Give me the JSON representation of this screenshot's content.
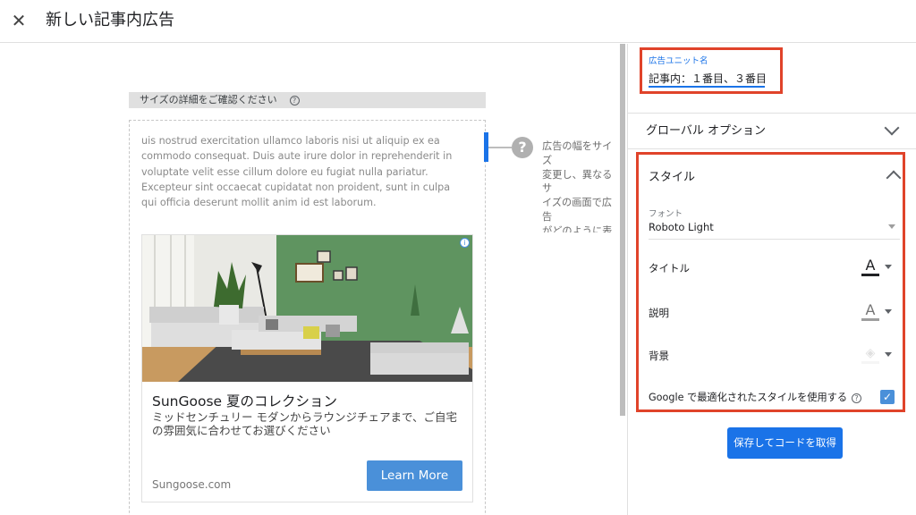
{
  "header": {
    "close_glyph": "✕",
    "title": "新しい記事内広告"
  },
  "preview": {
    "size_header": "サイズの詳細をご確認ください",
    "help_glyph": "?",
    "lorem_text": "uis nostrud exercitation ullamco laboris nisi ut aliquip ex ea commodo consequat. Duis aute irure dolor in reprehenderit in voluptate velit esse cillum dolore eu fugiat nulla pariatur. Excepteur sint occaecat cupidatat non proident, sunt in culpa qui officia deserunt mollit anim id est laborum.",
    "ad": {
      "info_glyph": "i",
      "title": "SunGoose 夏のコレクション",
      "description": "ミッドセンチュリー モダンからラウンジチェアまで、ご自宅の雰囲気に合わせてお選びください",
      "domain": "Sungoose.com",
      "cta": "Learn More"
    },
    "side_help_glyph": "?",
    "side_help_text": "広告の幅をサイズ\n変更し、異なるサ\nイズの画面で広告\nがどのように表示\nされるか確認しま\nす"
  },
  "settings": {
    "ad_unit": {
      "label": "広告ユニット名",
      "value": "記事内：１番目、３番目"
    },
    "global_options_label": "グローバル オプション",
    "style": {
      "title": "スタイル",
      "font_label": "フォント",
      "font_value": "Roboto Light",
      "rows": [
        {
          "label": "タイトル",
          "glyph": "A",
          "glyph_color": "#202124",
          "bar_color": "#202124"
        },
        {
          "label": "説明",
          "glyph": "A",
          "glyph_color": "#757575",
          "bar_color": "#9e9e9e"
        },
        {
          "label": "背景",
          "glyph": "◈",
          "glyph_color": "#e8e8e8",
          "bar_color": "#f5f5f5"
        }
      ],
      "google_optimized_label": "Google で最適化されたスタイルを使用する",
      "google_optimized_help": "?",
      "google_optimized_checked": true,
      "check_glyph": "✓"
    },
    "save_button": "保存してコードを取得"
  }
}
